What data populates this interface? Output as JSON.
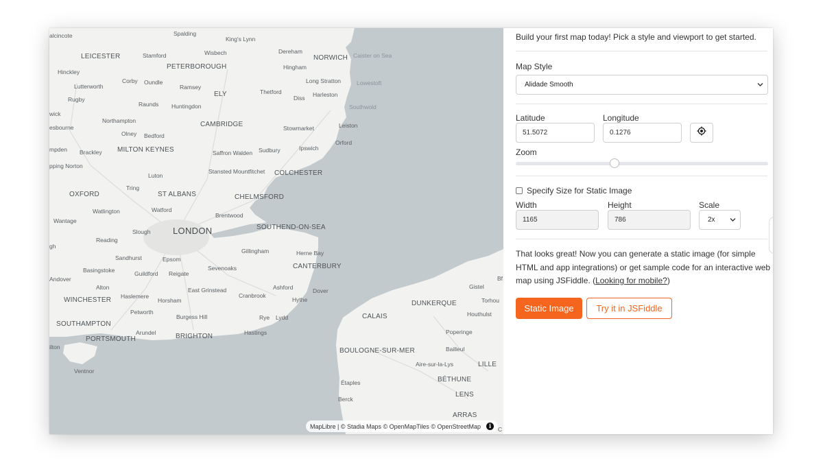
{
  "map": {
    "labels": [
      {
        "text": "Spalding"
      },
      {
        "text": "King's Lynn"
      },
      {
        "text": "alcincote"
      },
      {
        "text": "LEICESTER"
      },
      {
        "text": "Stamford"
      },
      {
        "text": "Wisbech"
      },
      {
        "text": "Dereham"
      },
      {
        "text": "NORWICH"
      },
      {
        "text": "Caister on Sea"
      },
      {
        "text": "PETERBOROUGH"
      },
      {
        "text": "Hingham"
      },
      {
        "text": "Hinckley"
      },
      {
        "text": "Corby"
      },
      {
        "text": "Oundle"
      },
      {
        "text": "Long Stratton"
      },
      {
        "text": "Lowestoft"
      },
      {
        "text": "Lutterworth"
      },
      {
        "text": "Ramsey"
      },
      {
        "text": "ELY"
      },
      {
        "text": "Thetford"
      },
      {
        "text": "Harleston"
      },
      {
        "text": "Rugby"
      },
      {
        "text": "Diss"
      },
      {
        "text": "Raunds"
      },
      {
        "text": "Huntingdon"
      },
      {
        "text": "Southwold"
      },
      {
        "text": "wick"
      },
      {
        "text": "Northampton"
      },
      {
        "text": "esbourne"
      },
      {
        "text": "CAMBRIDGE"
      },
      {
        "text": "Stowmarket"
      },
      {
        "text": "Leiston"
      },
      {
        "text": "Olney"
      },
      {
        "text": "Bedford"
      },
      {
        "text": "Orford"
      },
      {
        "text": "mpden"
      },
      {
        "text": "Brackley"
      },
      {
        "text": "MILTON KEYNES"
      },
      {
        "text": "Ipswich"
      },
      {
        "text": "Saffron Walden"
      },
      {
        "text": "Sudbury"
      },
      {
        "text": "pping Norton"
      },
      {
        "text": "Stansted Mountfitchet"
      },
      {
        "text": "Luton"
      },
      {
        "text": "COLCHESTER"
      },
      {
        "text": "Tring"
      },
      {
        "text": "OXFORD"
      },
      {
        "text": "ST ALBANS"
      },
      {
        "text": "CHELMSFORD"
      },
      {
        "text": "Watlington"
      },
      {
        "text": "Watford"
      },
      {
        "text": "Brentwood"
      },
      {
        "text": "Wantage"
      },
      {
        "text": "SOUTHEND-ON-SEA"
      },
      {
        "text": "Slough"
      },
      {
        "text": "LONDON"
      },
      {
        "text": "Reading"
      },
      {
        "text": "gh"
      },
      {
        "text": "Gillingham"
      },
      {
        "text": "Herne Bay"
      },
      {
        "text": "Sandhurst"
      },
      {
        "text": "Epsom"
      },
      {
        "text": "Basingstoke"
      },
      {
        "text": "Sevenoaks"
      },
      {
        "text": "CANTERBURY"
      },
      {
        "text": "Guildford"
      },
      {
        "text": "Reigate"
      },
      {
        "text": "Andover"
      },
      {
        "text": "Alton"
      },
      {
        "text": "East Grinstead"
      },
      {
        "text": "Ashford"
      },
      {
        "text": "Dover"
      },
      {
        "text": "Haslemere"
      },
      {
        "text": "Horsham"
      },
      {
        "text": "Cranbrook"
      },
      {
        "text": "Hythe"
      },
      {
        "text": "WINCHESTER"
      },
      {
        "text": "Petworth"
      },
      {
        "text": "Burgess Hill"
      },
      {
        "text": "Rye"
      },
      {
        "text": "Lydd"
      },
      {
        "text": "SOUTHAMPTON"
      },
      {
        "text": "Arundel"
      },
      {
        "text": "Hastings"
      },
      {
        "text": "PORTSMOUTH"
      },
      {
        "text": "BRIGHTON"
      },
      {
        "text": "Ventnor"
      },
      {
        "text": "Bf"
      },
      {
        "text": "Gistel"
      },
      {
        "text": "Torhou"
      },
      {
        "text": "DUNKERQUE"
      },
      {
        "text": "Houthulst"
      },
      {
        "text": "CALAIS"
      },
      {
        "text": "Poperinge"
      },
      {
        "text": "Bailleul"
      },
      {
        "text": "BOULOGNE-SUR-MER"
      },
      {
        "text": "Aire-sur-la-Lys"
      },
      {
        "text": "LILLE"
      },
      {
        "text": "BÉTHUNE"
      },
      {
        "text": "Étaples"
      },
      {
        "text": "LENS"
      },
      {
        "text": "Berck"
      },
      {
        "text": "ARRAS"
      },
      {
        "text": "ilton"
      },
      {
        "text": "C"
      }
    ],
    "attribution": "MapLibre | © Stadia Maps © OpenMapTiles © OpenStreetMap",
    "info_icon": "info-icon"
  },
  "panel": {
    "intro": "Build your first map today! Pick a style and viewport to get started.",
    "map_style_label": "Map Style",
    "map_style_value": "Alidade Smooth",
    "latitude_label": "Latitude",
    "latitude_value": "51.5072",
    "longitude_label": "Longitude",
    "longitude_value": "0.1276",
    "locate_icon": "crosshair-icon",
    "zoom_label": "Zoom",
    "zoom_fraction": 0.39,
    "specify_size_label": "Specify Size for Static Image",
    "specify_size_checked": false,
    "width_label": "Width",
    "width_value": "1165",
    "height_label": "Height",
    "height_value": "786",
    "scale_label": "Scale",
    "scale_value": "2x",
    "description": "That looks great! Now you can generate a static image (for simple HTML and app integrations) or get sample code for an interactive web map using JSFiddle.",
    "mobile_link": "Looking for mobile?",
    "static_image_button": "Static Image",
    "jsfiddle_button": "Try it in JSFiddle",
    "accent_color": "#f5651d"
  }
}
